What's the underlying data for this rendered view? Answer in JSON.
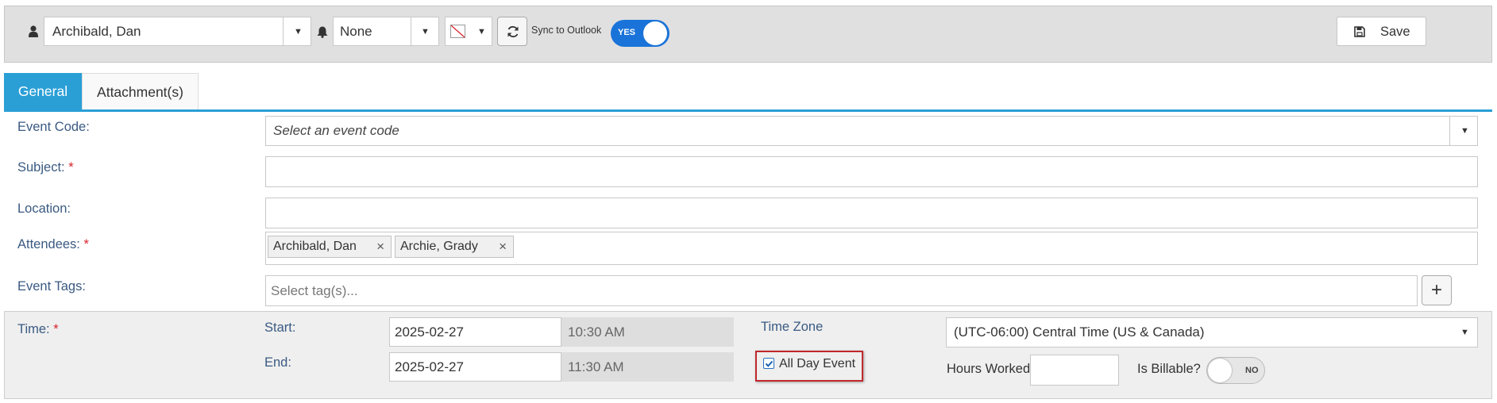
{
  "toolbar": {
    "owner": "Archibald, Dan",
    "reminder": "None",
    "sync_label": "Sync to Outlook",
    "sync_toggle": "YES",
    "save_label": "Save"
  },
  "tabs": [
    {
      "label": "General",
      "active": true
    },
    {
      "label": "Attachment(s)",
      "active": false
    }
  ],
  "form": {
    "event_code": {
      "label": "Event Code:",
      "placeholder": "Select an event code"
    },
    "subject": {
      "label": "Subject:",
      "required_mark": "*",
      "value": ""
    },
    "location": {
      "label": "Location:",
      "value": ""
    },
    "attendees": {
      "label": "Attendees:",
      "required_mark": "*",
      "items": [
        "Archibald, Dan",
        "Archie, Grady"
      ],
      "remove_glyph": "×"
    },
    "event_tags": {
      "label": "Event Tags:",
      "placeholder": "Select tag(s)...",
      "add_glyph": "+"
    }
  },
  "time": {
    "label": "Time:",
    "required_mark": "*",
    "start_label": "Start:",
    "start_date": "2025-02-27",
    "start_time": "10:30 AM",
    "end_label": "End:",
    "end_date": "2025-02-27",
    "end_time": "11:30 AM",
    "timezone_label": "Time Zone",
    "timezone": "(UTC-06:00) Central Time (US & Canada)",
    "all_day_label": "All Day Event",
    "all_day_checked": true,
    "hours_worked_label": "Hours Worked",
    "hours_worked": "",
    "billable_label": "Is Billable?",
    "billable_toggle": "NO"
  },
  "colors": {
    "accent": "#2a9fd6",
    "toggle_on": "#1a73d9",
    "label": "#3a5a82",
    "required": "#d9232b",
    "highlight_border": "#c0282d"
  }
}
